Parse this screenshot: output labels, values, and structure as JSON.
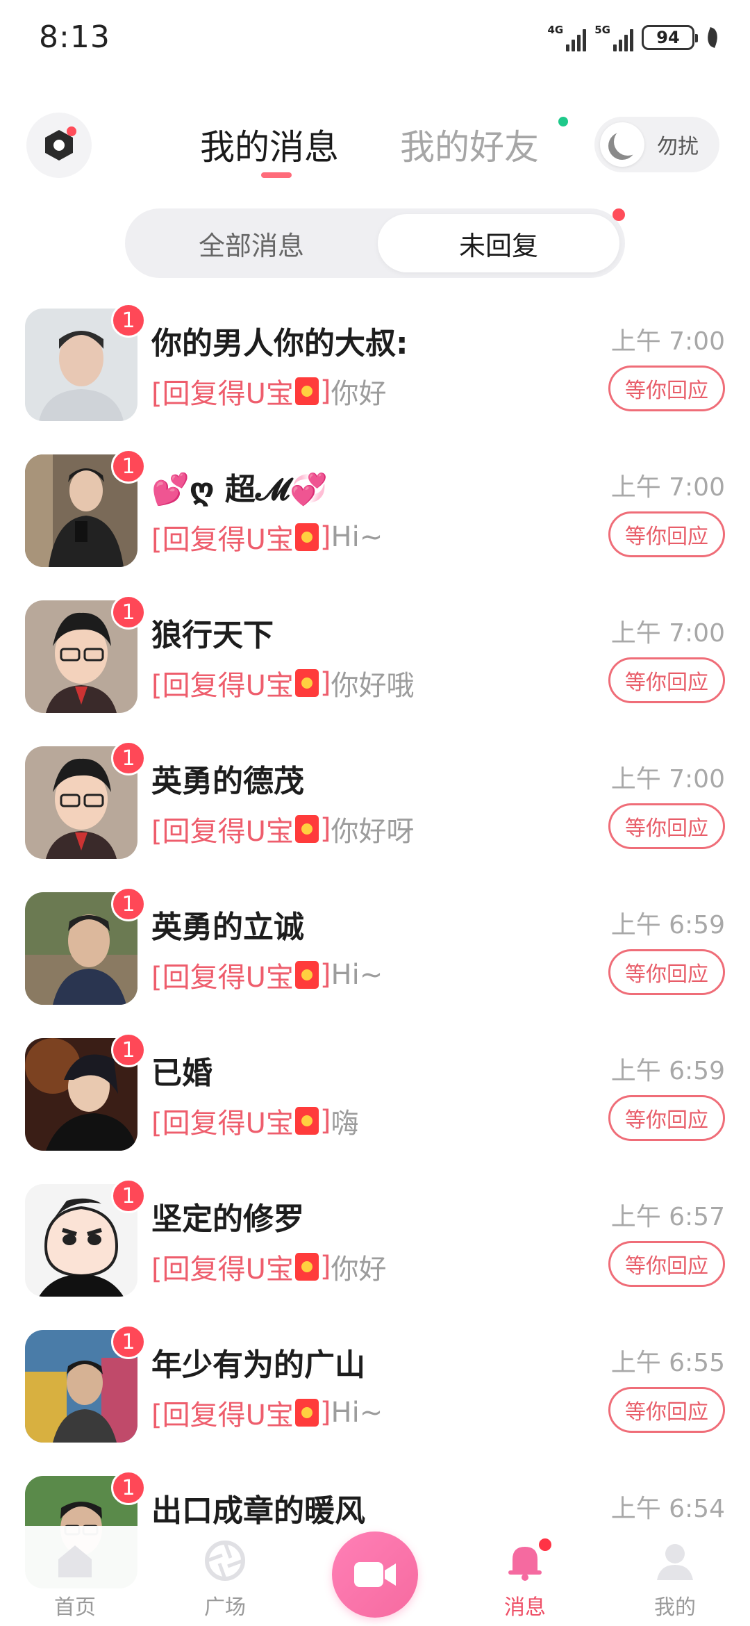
{
  "status_bar": {
    "time": "8:13",
    "net1": "4G",
    "net2": "5G",
    "battery": "94"
  },
  "header": {
    "tab_messages": "我的消息",
    "tab_friends": "我的好友",
    "dnd_label": "勿扰"
  },
  "segment": {
    "all": "全部消息",
    "unreplied": "未回复"
  },
  "colors": {
    "accent": "#ee5d6c",
    "badge": "#ff4857",
    "online_dot": "#1ec98a"
  },
  "messages": [
    {
      "name": "你的男人你的大叔:",
      "prefix_open": "[回复得U宝",
      "prefix_close": "]",
      "text": "你好",
      "time": "上午 7:00",
      "badge": "1",
      "action": "等你回应"
    },
    {
      "name": "💕ღ 超𝓜💞",
      "prefix_open": "[回复得U宝",
      "prefix_close": "]",
      "text": "Hi~",
      "time": "上午 7:00",
      "badge": "1",
      "action": "等你回应"
    },
    {
      "name": "狼行天下",
      "prefix_open": "[回复得U宝",
      "prefix_close": "]",
      "text": "你好哦",
      "time": "上午 7:00",
      "badge": "1",
      "action": "等你回应"
    },
    {
      "name": "英勇的德茂",
      "prefix_open": "[回复得U宝",
      "prefix_close": "]",
      "text": "你好呀",
      "time": "上午 7:00",
      "badge": "1",
      "action": "等你回应"
    },
    {
      "name": "英勇的立诚",
      "prefix_open": "[回复得U宝",
      "prefix_close": "]",
      "text": "Hi~",
      "time": "上午 6:59",
      "badge": "1",
      "action": "等你回应"
    },
    {
      "name": "已婚",
      "prefix_open": "[回复得U宝",
      "prefix_close": "]",
      "text": "嗨",
      "time": "上午 6:59",
      "badge": "1",
      "action": "等你回应"
    },
    {
      "name": "坚定的修罗",
      "prefix_open": "[回复得U宝",
      "prefix_close": "]",
      "text": "你好",
      "time": "上午 6:57",
      "badge": "1",
      "action": "等你回应"
    },
    {
      "name": "年少有为的广山",
      "prefix_open": "[回复得U宝",
      "prefix_close": "]",
      "text": "Hi~",
      "time": "上午 6:55",
      "badge": "1",
      "action": "等你回应"
    },
    {
      "name": "出口成章的暖风",
      "time": "上午 6:54",
      "badge": "1"
    }
  ],
  "bottom_nav": {
    "home": "首页",
    "square": "广场",
    "messages": "消息",
    "me": "我的"
  }
}
